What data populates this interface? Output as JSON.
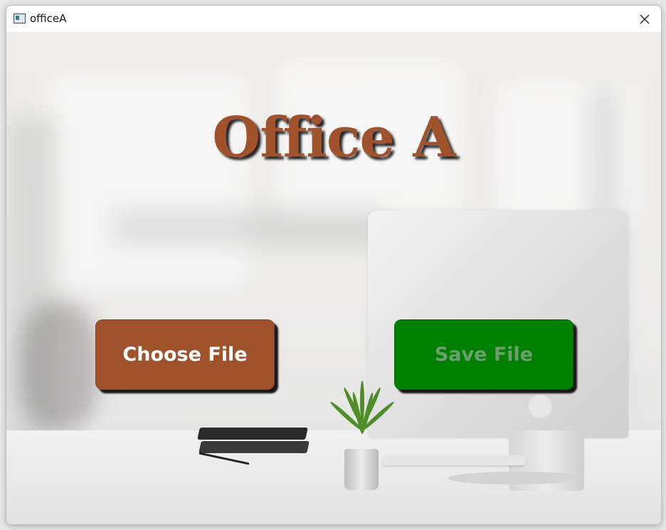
{
  "window": {
    "title": "officeA",
    "app_icon": "window-app-icon",
    "close_icon": "close-icon"
  },
  "main": {
    "heading": "Office A",
    "choose_file_label": "Choose File",
    "save_file_label": "Save File",
    "save_file_enabled": false
  },
  "colors": {
    "heading": "#a0522d",
    "choose_button": "#a0522d",
    "save_button": "#008000",
    "save_button_text": "#6d9f6d"
  }
}
